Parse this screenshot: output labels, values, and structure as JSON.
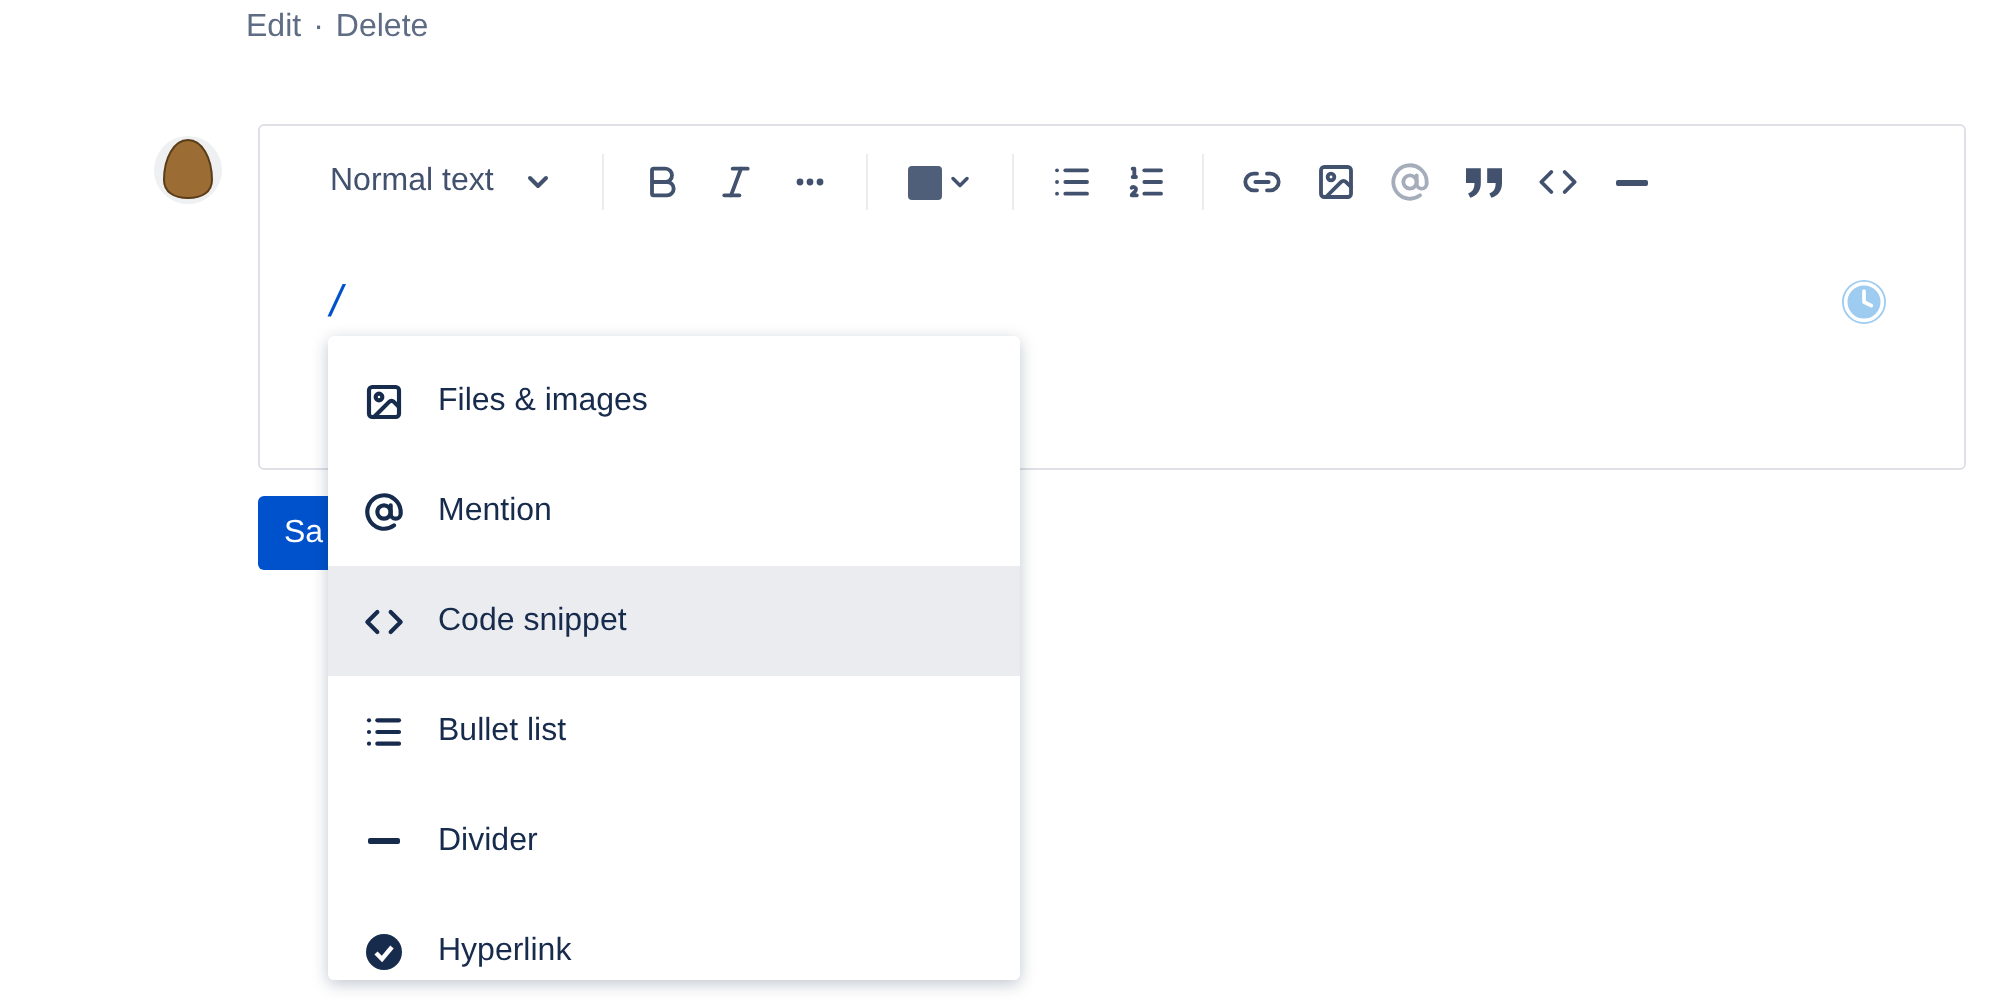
{
  "comment_actions": {
    "edit": "Edit",
    "separator": "·",
    "delete": "Delete"
  },
  "toolbar": {
    "text_style": "Normal text",
    "groups": [
      [
        {
          "disabled": false
        },
        {
          "disabled": false
        },
        {
          "disabled": false
        }
      ],
      [
        {
          "disabled": false
        }
      ],
      [
        {
          "disabled": false
        },
        {
          "disabled": false
        }
      ],
      [
        {
          "disabled": false
        },
        {
          "disabled": false
        },
        {
          "disabled": true
        },
        {
          "disabled": false
        },
        {
          "disabled": false
        },
        {
          "disabled": false
        }
      ]
    ]
  },
  "editor": {
    "value": "/"
  },
  "save_button": {
    "label": "Sa"
  },
  "insert_menu": [
    {
      "label": "Files & images",
      "selected": false
    },
    {
      "label": "Mention",
      "selected": false
    },
    {
      "label": "Code snippet",
      "selected": true
    },
    {
      "label": "Bullet list",
      "selected": false
    },
    {
      "label": "Divider",
      "selected": false
    },
    {
      "label": "Hyperlink",
      "selected": false
    }
  ]
}
